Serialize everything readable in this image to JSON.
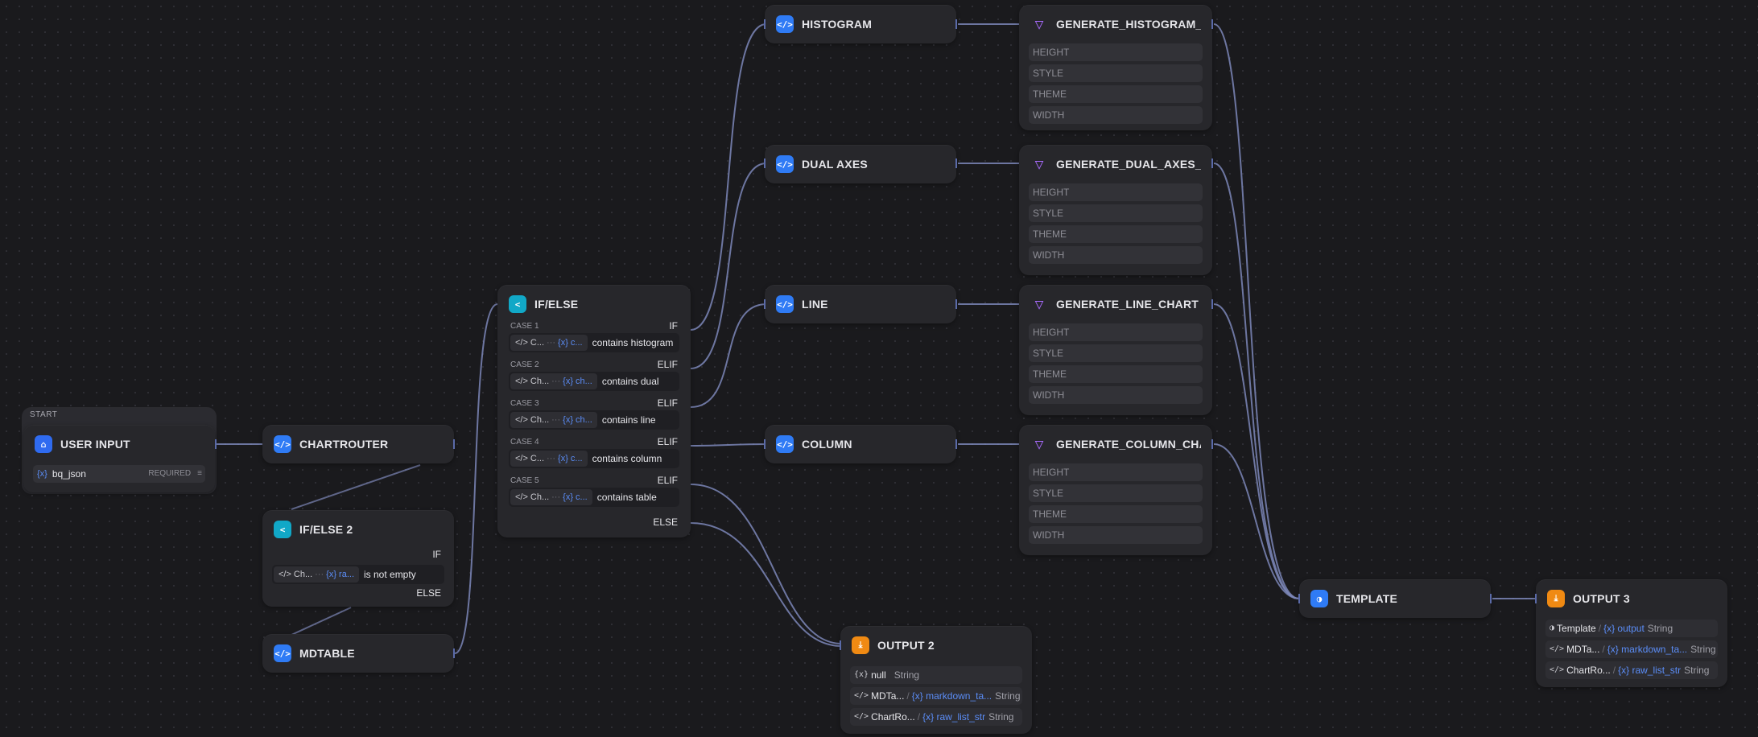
{
  "start": {
    "tag": "START",
    "title": "USER INPUT",
    "var_icon": "{x}",
    "var_name": "bq_json",
    "required": "REQUIRED"
  },
  "chartrouter": {
    "title": "CHARTROUTER"
  },
  "ifelse2": {
    "title": "IF/ELSE 2",
    "if": "IF",
    "cond_var": "Ch...",
    "cond_dots": "···",
    "cond_x": "{x} ra...",
    "cond_op": "is not empty",
    "else": "ELSE"
  },
  "mdtable": {
    "title": "MDTABLE"
  },
  "ifelse": {
    "title": "IF/ELSE",
    "cases": [
      {
        "label": "CASE 1",
        "kw": "IF",
        "var": "C...",
        "x": "{x} c...",
        "op": "contains histogram"
      },
      {
        "label": "CASE 2",
        "kw": "ELIF",
        "var": "Ch...",
        "x": "{x} ch...",
        "op": "contains dual"
      },
      {
        "label": "CASE 3",
        "kw": "ELIF",
        "var": "Ch...",
        "x": "{x} ch...",
        "op": "contains line"
      },
      {
        "label": "CASE 4",
        "kw": "ELIF",
        "var": "C...",
        "x": "{x} c...",
        "op": "contains column"
      },
      {
        "label": "CASE 5",
        "kw": "ELIF",
        "var": "Ch...",
        "x": "{x} c...",
        "op": "contains table"
      }
    ],
    "dots": "···",
    "else": "ELSE"
  },
  "code_nodes": {
    "histogram": "HISTOGRAM",
    "dual": "DUAL AXES",
    "line": "LINE",
    "column": "COLUMN"
  },
  "llm_nodes": {
    "histogram": "GENERATE_HISTOGRAM_CHART",
    "dual": "GENERATE_DUAL_AXES_CHART",
    "line": "GENERATE_LINE_CHART",
    "column": "GENERATE_COLUMN_CHART",
    "params": [
      "HEIGHT",
      "STYLE",
      "THEME",
      "WIDTH"
    ]
  },
  "output2": {
    "title": "OUTPUT 2",
    "rows": [
      {
        "icon": "{x}",
        "src": "null",
        "dim": "",
        "var": "",
        "type": "String"
      },
      {
        "icon": "</>",
        "src": "MDTa...",
        "dim": "/",
        "var": "{x} markdown_ta...",
        "type": "String"
      },
      {
        "icon": "</>",
        "src": "ChartRo...",
        "dim": "/",
        "var": "{x} raw_list_str",
        "type": "String"
      }
    ]
  },
  "template": {
    "title": "TEMPLATE"
  },
  "output3": {
    "title": "OUTPUT 3",
    "rows": [
      {
        "icon": "◑",
        "src": "Template",
        "dim": "/",
        "var": "{x} output",
        "type": "String"
      },
      {
        "icon": "</>",
        "src": "MDTa...",
        "dim": "/",
        "var": "{x} markdown_ta...",
        "type": "String"
      },
      {
        "icon": "</>",
        "src": "ChartRo...",
        "dim": "/",
        "var": "{x} raw_list_str",
        "type": "String"
      }
    ]
  },
  "icons": {
    "code": "code-icon",
    "ifelse": "branch-icon",
    "start": "home-icon",
    "llm": "llm-icon",
    "output": "output-icon",
    "template": "template-icon"
  },
  "colors": {
    "edge": "#7d87b8",
    "code_icon": "#2f7bf5",
    "ifelse_icon": "#11a8c7",
    "output_icon": "#f08a13",
    "llm_icon": "#a96bff"
  }
}
